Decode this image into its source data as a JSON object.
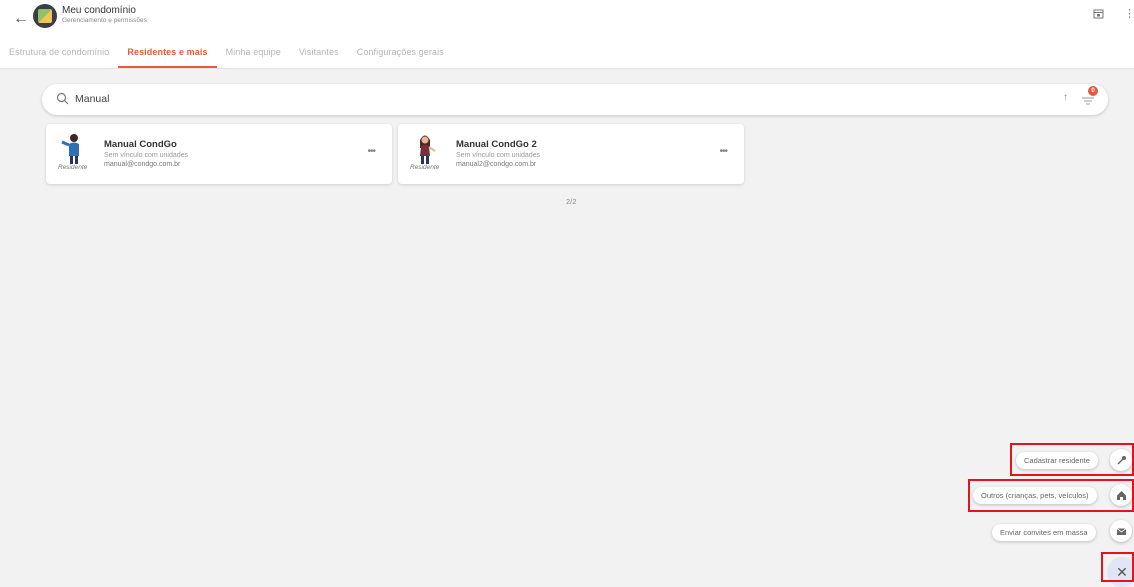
{
  "header": {
    "title": "Meu condomínio",
    "subtitle": "Gerenciamento e permissões"
  },
  "tabs": [
    {
      "label": "Estrutura de condomínio",
      "active": false
    },
    {
      "label": "Residentes e mais",
      "active": true
    },
    {
      "label": "Minha equipe",
      "active": false
    },
    {
      "label": "Visitantes",
      "active": false
    },
    {
      "label": "Configurações gerais",
      "active": false
    }
  ],
  "search": {
    "value": "Manual"
  },
  "filter": {
    "badge": "0"
  },
  "cards": [
    {
      "name": "Manual CondGo",
      "units": "Sem vínculo com unidades",
      "email": "manual@condgo.com.br",
      "role": "Residente"
    },
    {
      "name": "Manual CondGo 2",
      "units": "Sem vínculo com unidades",
      "email": "manual2@condgo.com.br",
      "role": "Residente"
    }
  ],
  "count": "2/2",
  "fab": {
    "items": [
      {
        "label": "Cadastrar residente",
        "icon": "key-icon"
      },
      {
        "label": "Outros (crianças, pets, veículos)",
        "icon": "home-icon"
      },
      {
        "label": "Enviar convites em massa",
        "icon": "mail-icon"
      }
    ],
    "close_icon": "close-icon"
  },
  "colors": {
    "accent": "#e35b3e",
    "highlight": "#e5141c",
    "fab": "#dfe6f6"
  }
}
